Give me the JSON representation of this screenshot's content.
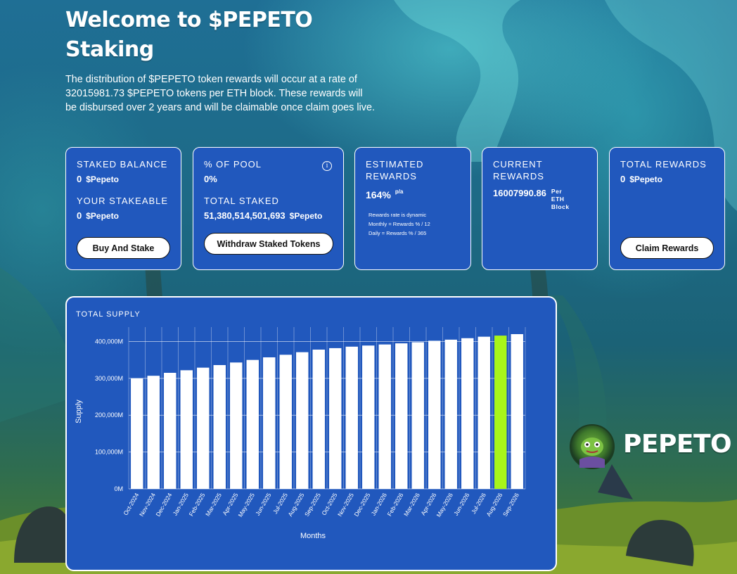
{
  "hero": {
    "title": "Welcome to $PEPETO Staking",
    "description": "The distribution of $PEPETO token rewards will occur at a rate of 32015981.73 $PEPETO tokens per ETH block. These rewards will be disbursed over 2 years and will be claimable once claim goes live."
  },
  "cards": {
    "staked": {
      "staked_balance_label": "STAKED BALANCE",
      "staked_balance_value": "0",
      "unit": "$Pepeto",
      "stakeable_label": "YOUR STAKEABLE",
      "stakeable_value": "0",
      "button": "Buy And Stake"
    },
    "pool": {
      "percent_label": "% OF POOL",
      "percent_value": "0%",
      "total_staked_label": "TOTAL STAKED",
      "total_staked_value": "51,380,514,501,693",
      "unit": "$Pepeto",
      "button": "Withdraw Staked Tokens",
      "icon": "info-icon"
    },
    "estimated": {
      "label_line1": "ESTIMATED",
      "label_line2": "REWARDS",
      "value": "164%",
      "suffix": "p/a",
      "note1": "Rewards rate is dynamic",
      "note2": "Monthly = Rewards % / 12",
      "note3": "Daily = Rewards % / 365"
    },
    "current": {
      "label_line1": "CURRENT",
      "label_line2": "REWARDS",
      "value": "16007990.86",
      "per1": "Per",
      "per2": "ETH",
      "per3": "Block"
    },
    "total": {
      "label": "TOTAL REWARDS",
      "value": "0",
      "unit": "$Pepeto",
      "button": "Claim Rewards"
    }
  },
  "chart_data": {
    "type": "bar",
    "title": "TOTAL SUPPLY",
    "xlabel": "Months",
    "ylabel": "Supply",
    "ylim": [
      0,
      420000
    ],
    "yticks": [
      0,
      100000,
      200000,
      300000,
      400000
    ],
    "ytick_labels": [
      "0M",
      "100,000M",
      "200,000M",
      "300,000M",
      "400,000M"
    ],
    "grid": true,
    "categories": [
      "Oct-2024",
      "Nov-2024",
      "Dec-2024",
      "Jan-2025",
      "Feb-2025",
      "Mar-2025",
      "Apr-2025",
      "May-2025",
      "Jun-2025",
      "Jul-2025",
      "Aug-2025",
      "Sep-2025",
      "Oct-2025",
      "Nov-2025",
      "Dec-2025",
      "Jan-2026",
      "Feb-2026",
      "Mar-2026",
      "Apr-2026",
      "May-2026",
      "Jun-2026",
      "Jul-2026",
      "Aug-2026",
      "Sep-2026"
    ],
    "values": [
      300000,
      307000,
      315000,
      322000,
      329000,
      336000,
      343000,
      350000,
      357000,
      364000,
      371000,
      378000,
      382000,
      386000,
      389000,
      392000,
      395000,
      398000,
      402000,
      405000,
      409000,
      413000,
      416000,
      420000
    ],
    "bar_color": "#ffffff",
    "highlight_index": 22,
    "highlight_color": "#a8f51a"
  },
  "logo": {
    "text": "PEPETO",
    "icon": "pepe-frog-avatar-icon"
  }
}
